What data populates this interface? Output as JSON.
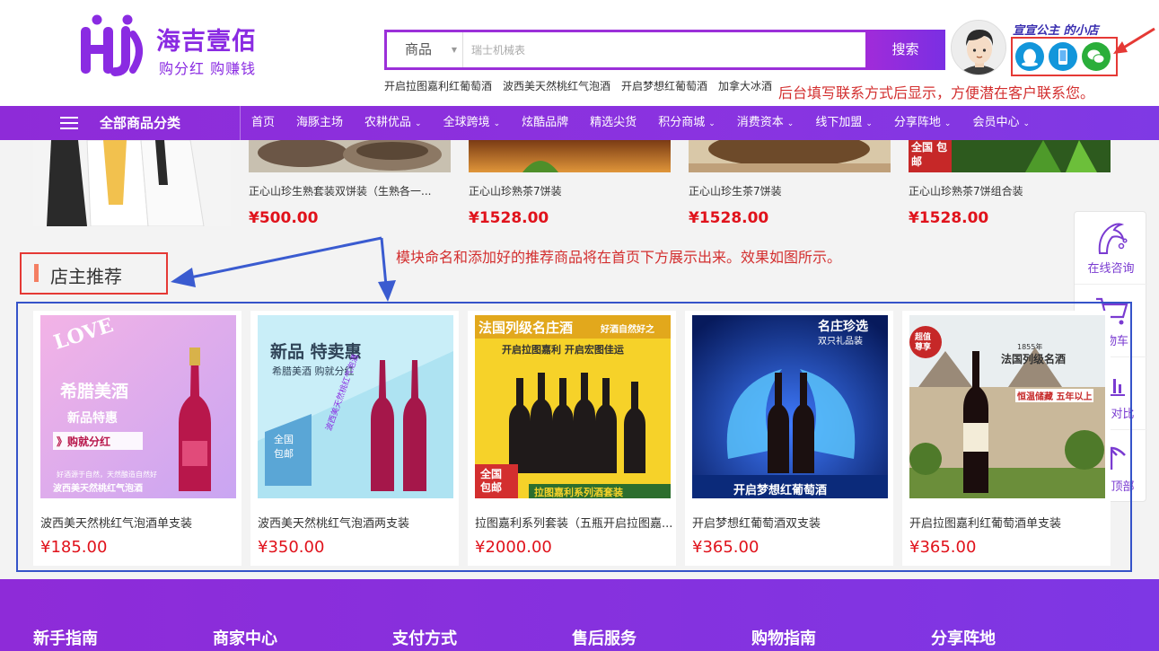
{
  "brand": {
    "name": "海吉壹佰",
    "slogan": "购分红 购赚钱",
    "logo_text": "HJ"
  },
  "search": {
    "category": "商品",
    "placeholder": "瑞士机械表",
    "button": "搜索",
    "hot_words": [
      "开启拉图嘉利红葡萄酒",
      "波西美天然桃红气泡酒",
      "开启梦想红葡萄酒",
      "加拿大冰酒"
    ]
  },
  "shop": {
    "owner_name": "宣宣公主 的小店",
    "contact_icons": [
      "qq-icon",
      "phone-icon",
      "wechat-icon"
    ]
  },
  "annotations": {
    "contact": "后台填写联系方式后显示，方便潜在客户联系您。",
    "module": "模块命名和添加好的推荐商品将在首页下方展示出来。效果如图所示。"
  },
  "nav": {
    "categories_label": "全部商品分类",
    "items": [
      {
        "label": "首页",
        "dropdown": false
      },
      {
        "label": "海豚主场",
        "dropdown": false
      },
      {
        "label": "农耕优品",
        "dropdown": true
      },
      {
        "label": "全球跨境",
        "dropdown": true
      },
      {
        "label": "炫酷品牌",
        "dropdown": false
      },
      {
        "label": "精选尖货",
        "dropdown": false
      },
      {
        "label": "积分商城",
        "dropdown": true
      },
      {
        "label": "消费资本",
        "dropdown": true
      },
      {
        "label": "线下加盟",
        "dropdown": true
      },
      {
        "label": "分享阵地",
        "dropdown": true
      },
      {
        "label": "会员中心",
        "dropdown": true
      }
    ]
  },
  "strip_products": [
    {
      "name": "正心山珍生熟套装双饼装（生熟各一...",
      "price": "¥500.00"
    },
    {
      "name": "正心山珍熟茶7饼装",
      "price": "¥1528.00"
    },
    {
      "name": "正心山珍生茶7饼装",
      "price": "¥1528.00"
    },
    {
      "name": "正心山珍熟茶7饼组合装",
      "price": "¥1528.00"
    }
  ],
  "strip_badge": "全国 包邮",
  "side_toolbar": [
    {
      "label": "在线咨询",
      "icon": "dolphin-icon"
    },
    {
      "label": "购物车",
      "icon": "cart-icon"
    },
    {
      "label": "商品对比",
      "icon": "chart-icon"
    },
    {
      "label": "回到顶部",
      "icon": "back-to-top-icon"
    }
  ],
  "recommend": {
    "title": "店主推荐",
    "products": [
      {
        "name": "波西美天然桃红气泡酒单支装",
        "price": "¥185.00",
        "img_texts": [
          "LOVE",
          "希腊美酒",
          "新品特惠",
          "》购就分红",
          "好酒源于自然，天然酿造自然好",
          "波西美天然桃红气泡酒"
        ]
      },
      {
        "name": "波西美天然桃红气泡酒两支装",
        "price": "¥350.00",
        "img_texts": [
          "新品 特卖惠",
          "希腊美酒 购就分红",
          "全国 包邮",
          "波西美天然桃红气泡酒"
        ]
      },
      {
        "name": "拉图嘉利系列套装（五瓶开启拉图嘉...",
        "price": "¥2000.00",
        "img_texts": [
          "法国列级名庄酒",
          "好酒自然好之",
          "开启拉图嘉利 开启宏图佳运",
          "全国 包邮",
          "拉图嘉利系列酒套装"
        ]
      },
      {
        "name": "开启梦想红葡萄酒双支装",
        "price": "¥365.00",
        "img_texts": [
          "名庄珍选",
          "双只礼品装",
          "开启梦想红葡萄酒"
        ]
      },
      {
        "name": "开启拉图嘉利红葡萄酒单支装",
        "price": "¥365.00",
        "img_texts": [
          "超值尊享",
          "1855年",
          "法国列级名酒",
          "恒温储藏 五年以上"
        ]
      }
    ]
  },
  "footer": {
    "headings": [
      "新手指南",
      "商家中心",
      "支付方式",
      "售后服务",
      "购物指南",
      "分享阵地"
    ]
  }
}
